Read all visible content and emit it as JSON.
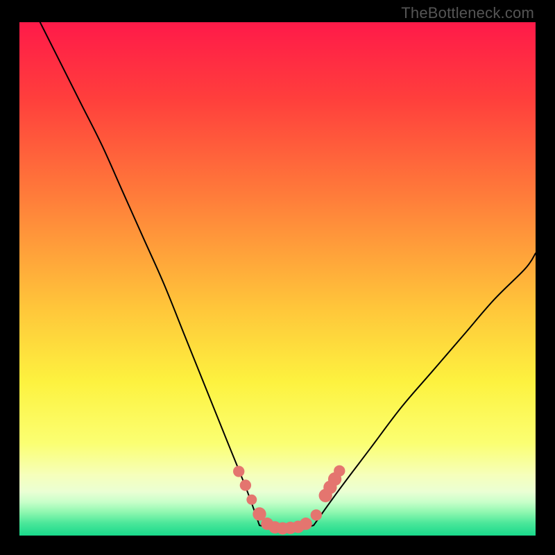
{
  "watermark": "TheBottleneck.com",
  "chart_data": {
    "type": "line",
    "title": "",
    "xlabel": "",
    "ylabel": "",
    "xlim": [
      0,
      100
    ],
    "ylim": [
      0,
      100
    ],
    "grid": false,
    "legend": false,
    "gradient_stops": [
      {
        "y": 0,
        "color": "#ff1a49"
      },
      {
        "y": 15,
        "color": "#ff3f3c"
      },
      {
        "y": 35,
        "color": "#ff803a"
      },
      {
        "y": 55,
        "color": "#ffc43a"
      },
      {
        "y": 70,
        "color": "#fdf23f"
      },
      {
        "y": 82,
        "color": "#fbff72"
      },
      {
        "y": 88,
        "color": "#f6ffb9"
      },
      {
        "y": 91.5,
        "color": "#eaffd4"
      },
      {
        "y": 93.5,
        "color": "#c7ffc9"
      },
      {
        "y": 95.5,
        "color": "#8cf7af"
      },
      {
        "y": 97.5,
        "color": "#4be79a"
      },
      {
        "y": 100,
        "color": "#16d88a"
      }
    ],
    "series": [
      {
        "name": "left-curve",
        "stroke": "#000000",
        "x": [
          4,
          8,
          12,
          16,
          20,
          24,
          28,
          32,
          36,
          40,
          44,
          46.5
        ],
        "y": [
          100,
          92,
          84,
          76,
          67,
          58,
          49,
          39,
          29,
          19,
          9,
          2
        ]
      },
      {
        "name": "valley-floor",
        "stroke": "#000000",
        "x": [
          46.5,
          50,
          54,
          57
        ],
        "y": [
          2,
          1.2,
          1.2,
          2
        ]
      },
      {
        "name": "right-curve",
        "stroke": "#000000",
        "x": [
          57,
          62,
          68,
          74,
          80,
          86,
          92,
          98,
          100
        ],
        "y": [
          2,
          9,
          17,
          25,
          32,
          39,
          46,
          52,
          55
        ]
      }
    ],
    "markers": {
      "name": "valley-dots",
      "color": "#e4756f",
      "points": [
        {
          "x": 42.5,
          "y": 12.5,
          "r": 1.1
        },
        {
          "x": 43.8,
          "y": 9.8,
          "r": 1.1
        },
        {
          "x": 45.0,
          "y": 7.0,
          "r": 1.0
        },
        {
          "x": 46.5,
          "y": 4.2,
          "r": 1.3
        },
        {
          "x": 48.0,
          "y": 2.3,
          "r": 1.2
        },
        {
          "x": 49.5,
          "y": 1.6,
          "r": 1.2
        },
        {
          "x": 51.0,
          "y": 1.4,
          "r": 1.2
        },
        {
          "x": 52.5,
          "y": 1.5,
          "r": 1.2
        },
        {
          "x": 54.0,
          "y": 1.7,
          "r": 1.2
        },
        {
          "x": 55.5,
          "y": 2.3,
          "r": 1.2
        },
        {
          "x": 57.5,
          "y": 4.0,
          "r": 1.1
        },
        {
          "x": 59.3,
          "y": 7.8,
          "r": 1.3
        },
        {
          "x": 60.2,
          "y": 9.4,
          "r": 1.3
        },
        {
          "x": 61.1,
          "y": 11.0,
          "r": 1.3
        },
        {
          "x": 62.0,
          "y": 12.6,
          "r": 1.1
        }
      ]
    }
  }
}
